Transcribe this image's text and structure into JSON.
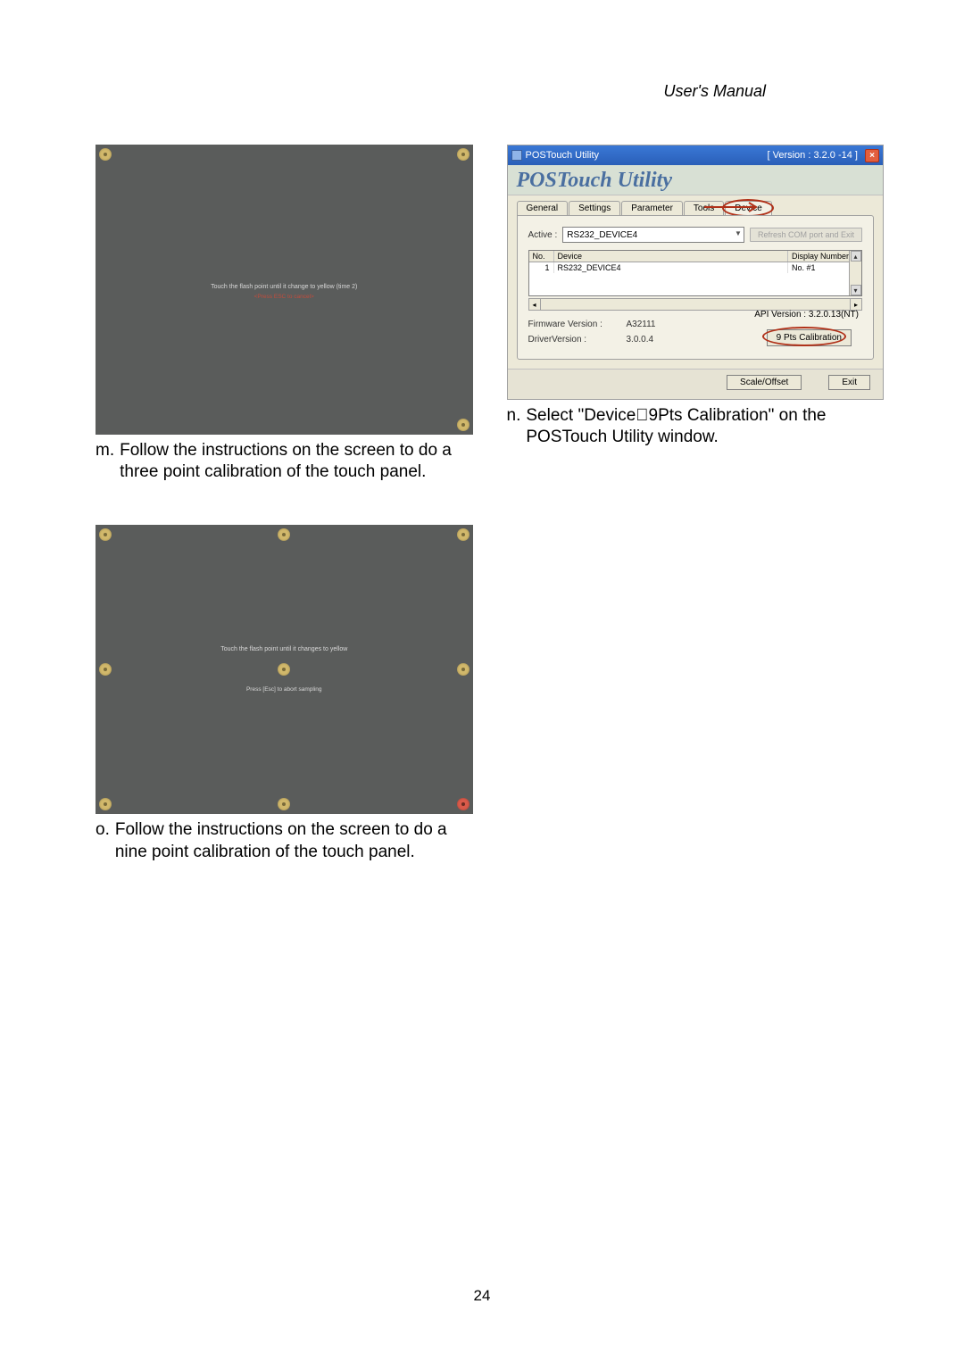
{
  "header": {
    "manual_label": "User's  Manual"
  },
  "page_number": "24",
  "step_m": {
    "letter": "m.",
    "text": "Follow the instructions on the screen to do a three point calibration of the touch panel.",
    "screen_line1": "Touch the flash point until it change to yellow (time 2)",
    "screen_line2": "<Press ESC to cancel>"
  },
  "step_n": {
    "letter": "n.",
    "text": "Select \"Device\u00009Pts Calibration\" on the POSTouch Utility window."
  },
  "step_o": {
    "letter": "o.",
    "text": "Follow the instructions on the screen to do a nine point calibration of the touch panel.",
    "screen_line1": "Touch the flash point until it changes to yellow",
    "screen_line2": "Press [Esc] to abort sampling"
  },
  "utility": {
    "title_left": "POSTouch Utility",
    "title_right": "[ Version : 3.2.0 -14 ]",
    "brand": "POSTouch Utility",
    "tabs": {
      "general": "General",
      "settings": "Settings",
      "parameter": "Parameter",
      "tools": "Tools",
      "device": "Device"
    },
    "active_label": "Active :",
    "active_value": "RS232_DEVICE4",
    "refresh_btn": "Refresh COM port and Exit",
    "grid": {
      "col_no": "No.",
      "col_device": "Device",
      "col_display": "Display Number",
      "row1_no": "1",
      "row1_device": "RS232_DEVICE4",
      "row1_display": "No. #1"
    },
    "fw_label": "Firmware Version :",
    "fw_value": "A32111",
    "drv_label": "DriverVersion :",
    "drv_value": "3.0.0.4",
    "api_label": "API Version :",
    "api_value": "3.2.0.13(NT)",
    "nine_btn": "9 Pts Calibration",
    "scale_btn": "Scale/Offset",
    "exit_btn": "Exit"
  }
}
